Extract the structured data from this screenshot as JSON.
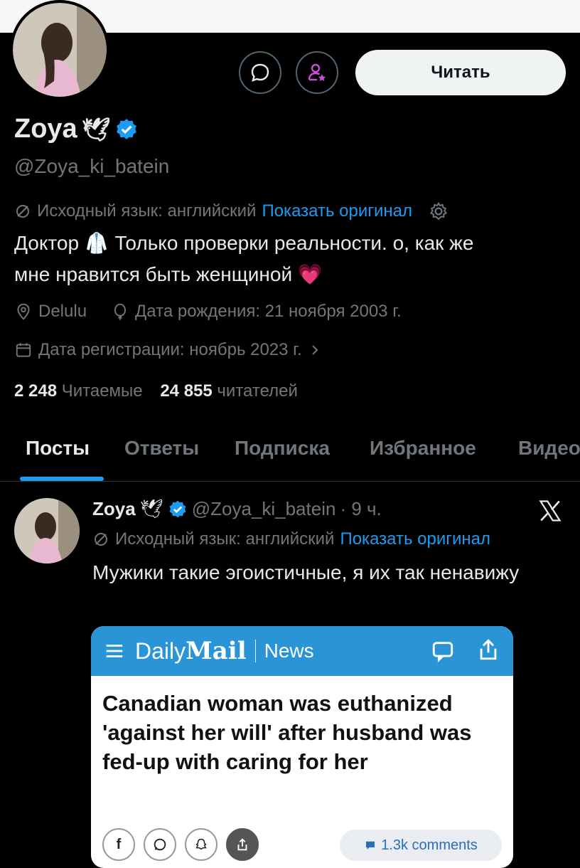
{
  "profile": {
    "name": "Zoya",
    "name_emoji": "🕊",
    "handle": "@Zoya_ki_batein",
    "follow_label": "Читать",
    "translate_note": "Исходный язык: английский",
    "show_original": "Показать оригинал",
    "bio_line1": "Доктор 🥼 Только проверки реальности. о, как же",
    "bio_line2": "мне нравится быть женщиной 💗",
    "location": "Delulu",
    "birthday": "Дата рождения: 21 ноября 2003 г.",
    "joined": "Дата регистрации: ноябрь 2023 г.",
    "following_count": "2 248",
    "following_label": "Читаемые",
    "followers_count": "24 855",
    "followers_label": "читателей"
  },
  "tabs": [
    "Посты",
    "Ответы",
    "Подписка",
    "Избранное",
    "Видео"
  ],
  "post": {
    "name": "Zoya",
    "name_emoji": "🕊",
    "handle": "@Zoya_ki_batein",
    "time": "· 9 ч.",
    "translate_note": "Исходный язык: английский",
    "show_original": "Показать оригинал",
    "text": "Мужики такие эгоистичные, я их так ненавижу",
    "card": {
      "brand_daily": "Daily",
      "brand_mail": "Mail",
      "section": "News",
      "headline": "Canadian woman was euthanized 'against her will' after husband was fed-up with caring for her",
      "comments": "1.3k comments"
    }
  },
  "colors": {
    "accent": "#1d9bf0",
    "verified": "#1d9bf0",
    "card_header": "#2a95d6"
  }
}
